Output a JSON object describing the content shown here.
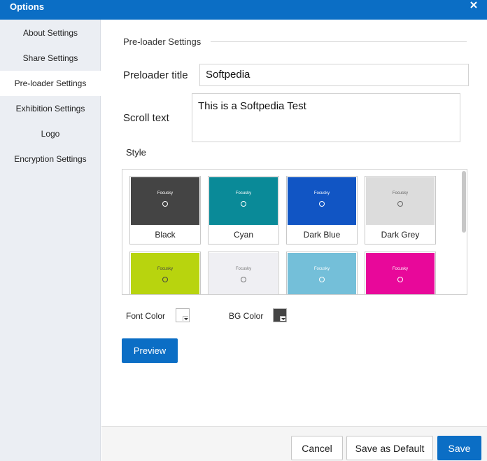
{
  "window": {
    "title": "Options",
    "close_icon": "close-icon"
  },
  "sidebar": {
    "items": [
      {
        "label": "About Settings",
        "active": false
      },
      {
        "label": "Share Settings",
        "active": false
      },
      {
        "label": "Pre-loader Settings",
        "active": true
      },
      {
        "label": "Exhibition Settings",
        "active": false
      },
      {
        "label": "Logo",
        "active": false
      },
      {
        "label": "Encryption Settings",
        "active": false
      }
    ]
  },
  "content": {
    "section_title": "Pre-loader Settings",
    "preloader_title_label": "Preloader title",
    "preloader_title_value": "Softpedia",
    "scroll_text_label": "Scroll text",
    "scroll_text_value": "This is a Softpedia Test",
    "style_label": "Style",
    "styles": [
      {
        "name": "Black",
        "color": "#444444",
        "text": "#ffffff"
      },
      {
        "name": "Cyan",
        "color": "#0a8a98",
        "text": "#ffffff"
      },
      {
        "name": "Dark Blue",
        "color": "#1155c4",
        "text": "#ffffff"
      },
      {
        "name": "Dark Grey",
        "color": "#dcdcdc",
        "text": "#666666"
      },
      {
        "name": "",
        "color": "#b8d40e",
        "text": "#444444"
      },
      {
        "name": "",
        "color": "#efeff3",
        "text": "#777777"
      },
      {
        "name": "",
        "color": "#74bfd9",
        "text": "#ffffff"
      },
      {
        "name": "",
        "color": "#e8089a",
        "text": "#ffffff"
      }
    ],
    "tile_brand": "Focusky",
    "font_color_label": "Font Color",
    "font_color_value": "#ffffff",
    "bg_color_label": "BG Color",
    "bg_color_value": "#444444",
    "preview_label": "Preview"
  },
  "footer": {
    "cancel_label": "Cancel",
    "save_default_label": "Save as Default",
    "save_label": "Save"
  },
  "colors": {
    "accent": "#0b6ec5",
    "sidebar_bg": "#ebeef3"
  }
}
